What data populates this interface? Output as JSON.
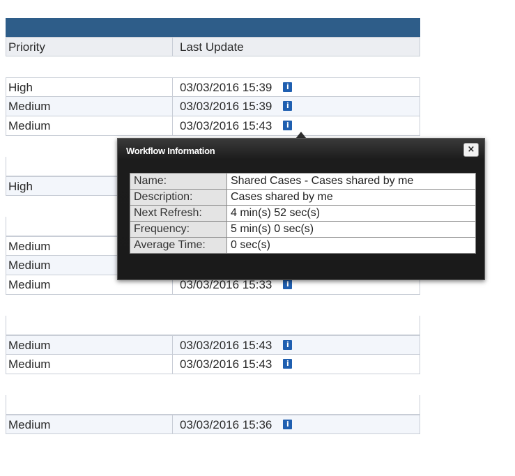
{
  "columns": {
    "priority": "Priority",
    "last_update": "Last Update"
  },
  "rows": [
    {
      "kind": "blank"
    },
    {
      "kind": "data",
      "priority": "High",
      "last_update": "03/03/2016 15:39"
    },
    {
      "kind": "data",
      "priority": "Medium",
      "last_update": "03/03/2016 15:39"
    },
    {
      "kind": "data",
      "priority": "Medium",
      "last_update": "03/03/2016 15:43"
    },
    {
      "kind": "blank"
    },
    {
      "kind": "blank"
    },
    {
      "kind": "data",
      "priority": "High",
      "last_update": ""
    },
    {
      "kind": "blank"
    },
    {
      "kind": "blank"
    },
    {
      "kind": "data",
      "priority": "Medium",
      "last_update": ""
    },
    {
      "kind": "data",
      "priority": "Medium",
      "last_update": ""
    },
    {
      "kind": "data",
      "priority": "Medium",
      "last_update": "03/03/2016 15:33"
    },
    {
      "kind": "blank"
    },
    {
      "kind": "blank"
    },
    {
      "kind": "data",
      "priority": "Medium",
      "last_update": "03/03/2016 15:43"
    },
    {
      "kind": "data",
      "priority": "Medium",
      "last_update": "03/03/2016 15:43"
    },
    {
      "kind": "blank"
    },
    {
      "kind": "blank"
    },
    {
      "kind": "data",
      "priority": "Medium",
      "last_update": "03/03/2016 15:36"
    }
  ],
  "info_icon": {
    "name": "info-icon",
    "glyph": "i",
    "color": "#1f5fb0"
  },
  "popup": {
    "title": "Workflow Information",
    "close_label": "×",
    "fields": [
      {
        "label": "Name:",
        "value": "Shared Cases - Cases shared by me"
      },
      {
        "label": "Description:",
        "value": "Cases shared by me"
      },
      {
        "label": "Next Refresh:",
        "value": "4 min(s) 52 sec(s)"
      },
      {
        "label": "Frequency:",
        "value": "5 min(s) 0 sec(s)"
      },
      {
        "label": "Average Time:",
        "value": "0 sec(s)"
      }
    ]
  },
  "colors": {
    "header_bar": "#2e5d89",
    "alt_row": "#f3f6fb",
    "popup_bg": "#1c1c1c"
  }
}
